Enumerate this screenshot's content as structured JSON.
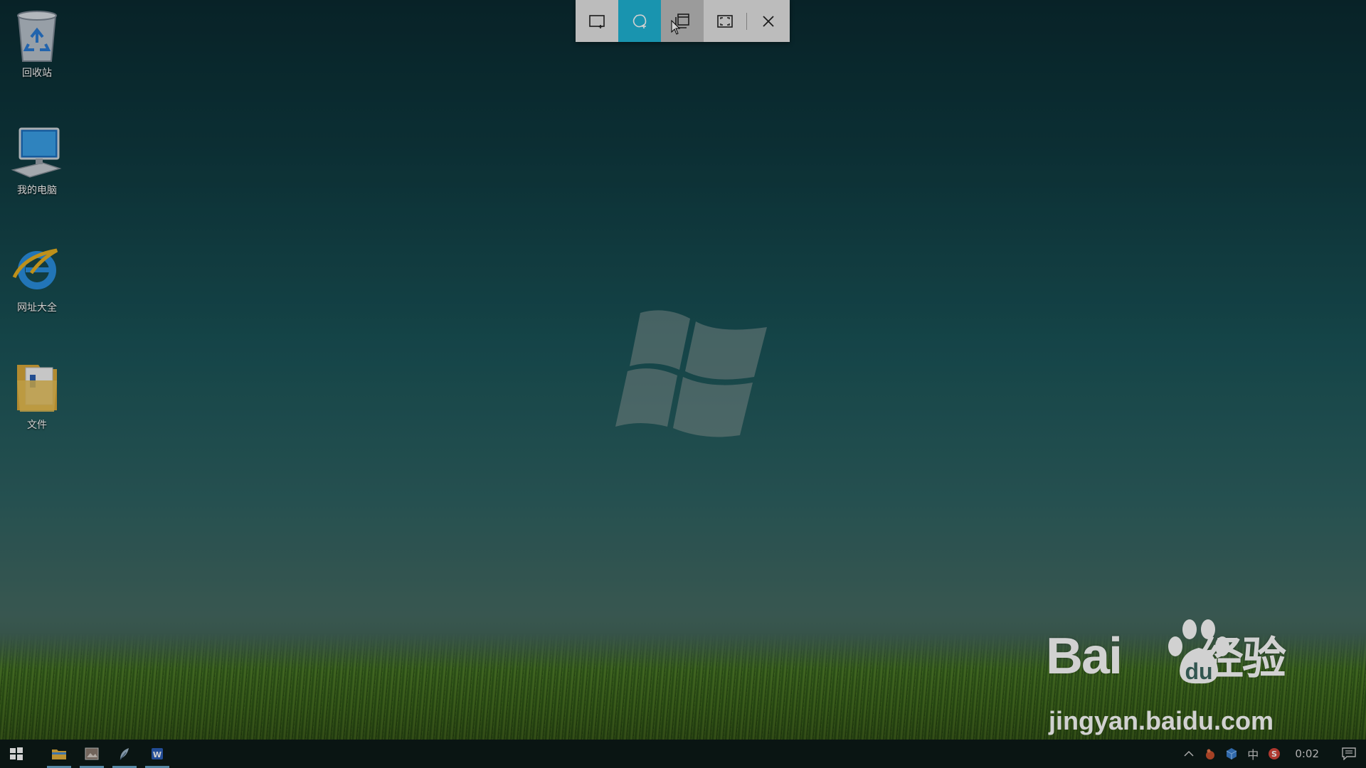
{
  "desktop": {
    "icons": [
      {
        "label": "回收站",
        "icon": "recycle-bin-icon"
      },
      {
        "label": "我的电脑",
        "icon": "computer-icon"
      },
      {
        "label": "网址大全",
        "icon": "internet-explorer-icon"
      },
      {
        "label": "文件",
        "icon": "folder-icon"
      }
    ]
  },
  "snip_toolbar": {
    "buttons": [
      {
        "icon": "rectangle-snip-icon",
        "state": "normal"
      },
      {
        "icon": "freeform-snip-icon",
        "state": "selected"
      },
      {
        "icon": "window-snip-icon",
        "state": "hover"
      },
      {
        "icon": "fullscreen-snip-icon",
        "state": "normal"
      },
      {
        "icon": "close-icon",
        "state": "normal"
      }
    ],
    "colors": {
      "selected": "#1fb5d6",
      "hover": "#bdbdbd",
      "bar": "#e6e6e6"
    }
  },
  "watermark": {
    "brand": "Bai",
    "brand_cn": "经验",
    "url": "jingyan.baidu.com"
  },
  "taskbar": {
    "items": [
      {
        "icon": "start-icon"
      },
      {
        "icon": "file-explorer-icon",
        "running": true
      },
      {
        "icon": "photos-icon",
        "running": true
      },
      {
        "icon": "feather-app-icon",
        "running": true
      },
      {
        "icon": "word-icon",
        "running": true
      }
    ],
    "tray": {
      "ime": "中",
      "clock": "0:02"
    }
  }
}
